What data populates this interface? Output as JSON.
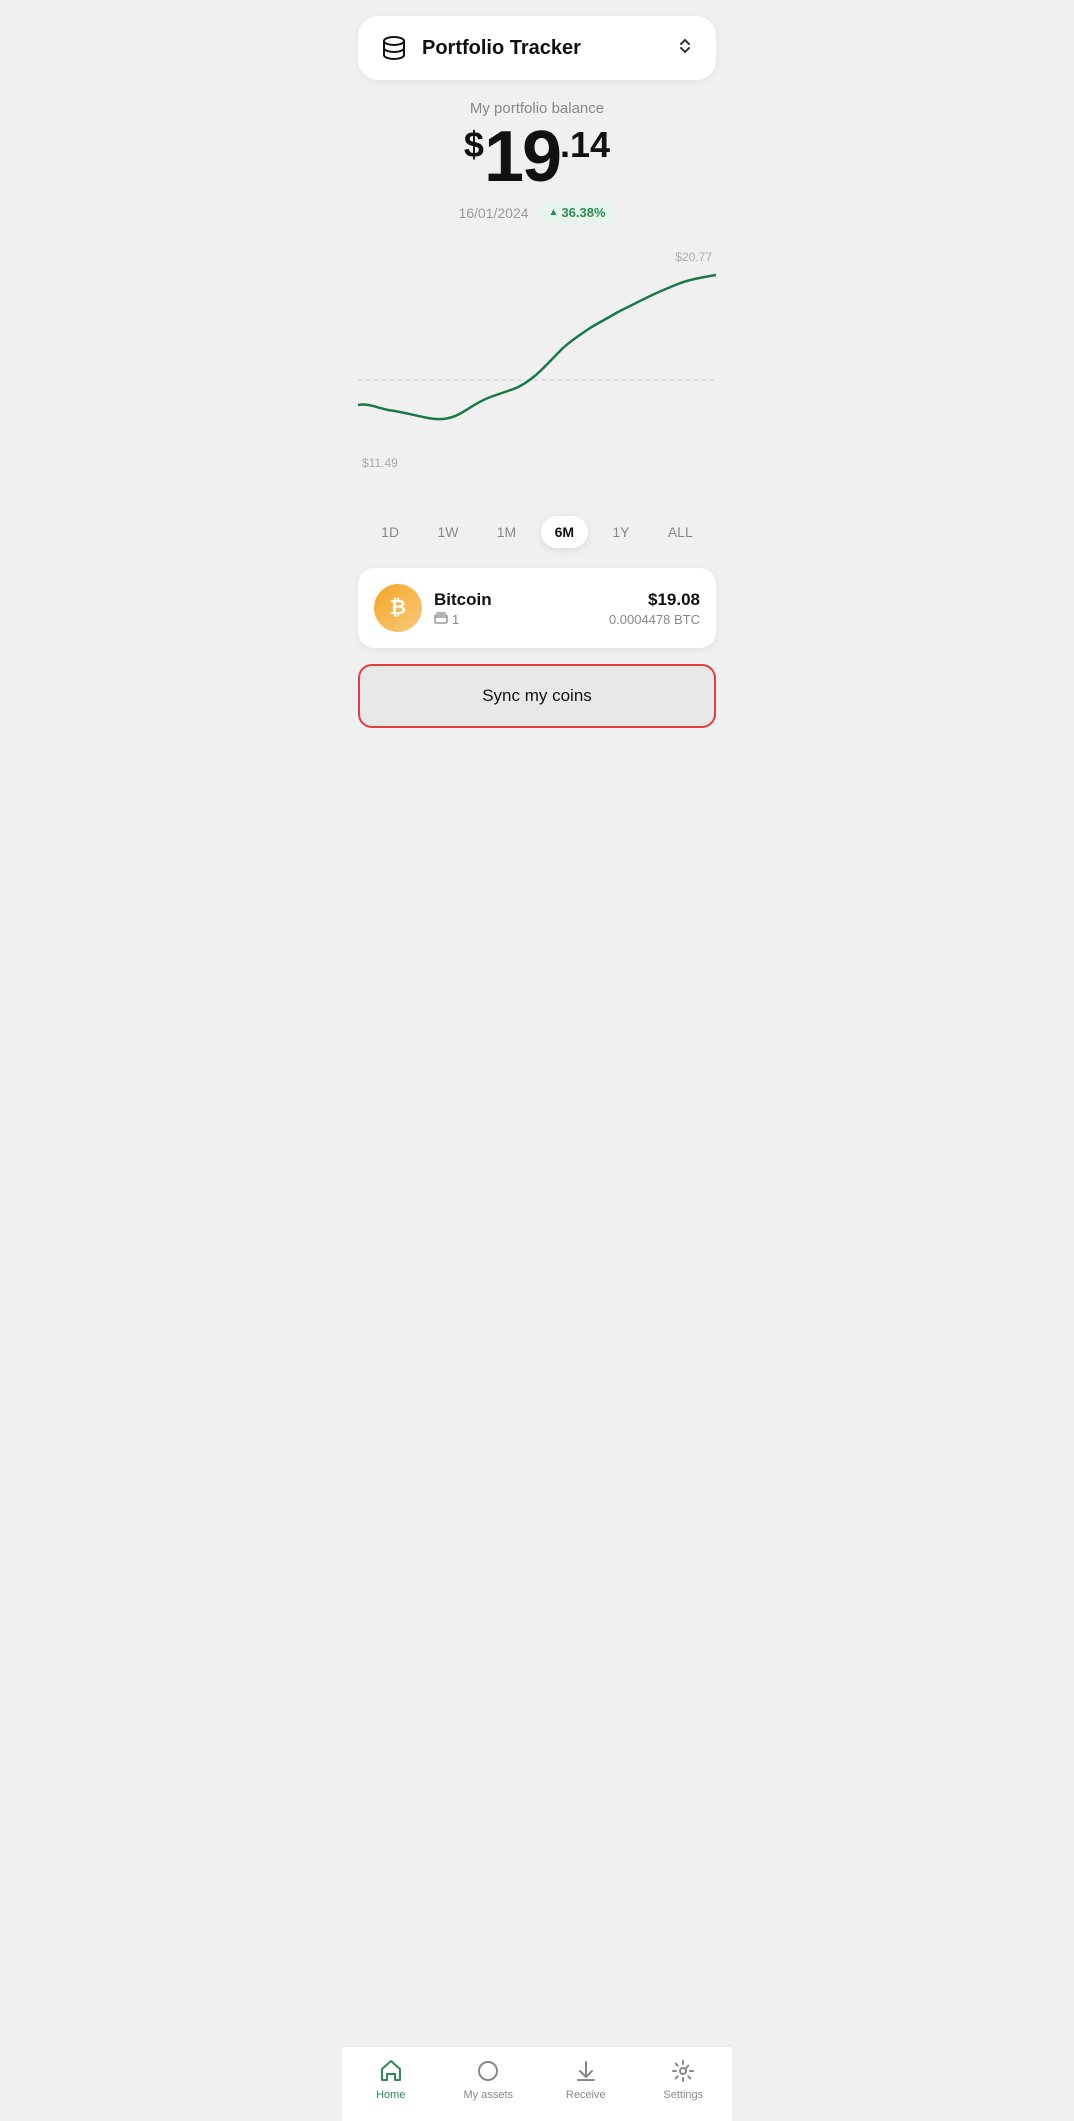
{
  "header": {
    "title": "Portfolio Tracker",
    "icon": "database"
  },
  "portfolio": {
    "label": "My portfolio balance",
    "currency_symbol": "$",
    "amount_main": "19",
    "amount_cents": ".14",
    "date": "16/01/2024",
    "change_percent": "36.38%",
    "change_arrow": "▲"
  },
  "chart": {
    "label_high": "$20.77",
    "label_low": "$11.49"
  },
  "time_filters": [
    {
      "label": "1D",
      "active": false
    },
    {
      "label": "1W",
      "active": false
    },
    {
      "label": "1M",
      "active": false
    },
    {
      "label": "6M",
      "active": true
    },
    {
      "label": "1Y",
      "active": false
    },
    {
      "label": "ALL",
      "active": false
    }
  ],
  "assets": [
    {
      "name": "Bitcoin",
      "wallet_count": "1",
      "value": "$19.08",
      "amount": "0.0004478 BTC",
      "icon": "₿"
    }
  ],
  "sync_button": {
    "label": "Sync my coins"
  },
  "bottom_nav": [
    {
      "label": "Home",
      "icon": "home",
      "active": true
    },
    {
      "label": "My assets",
      "icon": "circle",
      "active": false
    },
    {
      "label": "Receive",
      "icon": "receive",
      "active": false
    },
    {
      "label": "Settings",
      "icon": "settings",
      "active": false
    }
  ]
}
